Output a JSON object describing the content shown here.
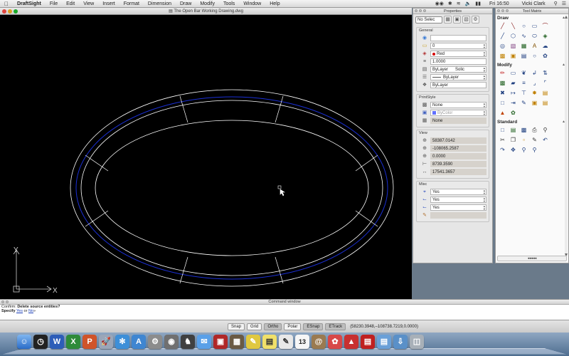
{
  "menubar": {
    "app_name": "DraftSight",
    "items": [
      "File",
      "Edit",
      "View",
      "Insert",
      "Format",
      "Dimension",
      "Draw",
      "Modify",
      "Tools",
      "Window",
      "Help"
    ],
    "clock": "Fri 16:50",
    "user": "Vicki Clark"
  },
  "drawing_window": {
    "title": "The Open Bar Working Drawing.dwg",
    "axis_y": "Y",
    "axis_x": "X",
    "colors": {
      "background": "#000000",
      "outline": "#ffffff",
      "centerline": "#1a2fd6"
    }
  },
  "properties": {
    "title": "Properties",
    "selector_value": "No Selec",
    "general": {
      "title": "General",
      "rows": [
        {
          "icon": "color-wheel-icon",
          "value": ""
        },
        {
          "icon": "layer-icon",
          "value": "0"
        },
        {
          "icon": "color-icon",
          "value": "Red"
        },
        {
          "icon": "scale-icon",
          "value": "1.0000"
        },
        {
          "icon": "linestyle-icon",
          "value": "ByLayer",
          "value2": "Solic"
        },
        {
          "icon": "lineweight-icon",
          "value": "ByLayer"
        },
        {
          "icon": "transparency-icon",
          "value": "ByLayer"
        }
      ]
    },
    "printstyle": {
      "title": "PrintStyle",
      "rows": [
        {
          "icon": "print-icon",
          "value": "None"
        },
        {
          "icon": "print-color-icon",
          "value": "ByColor"
        },
        {
          "icon": "print-table-icon",
          "value": "None"
        }
      ]
    },
    "view": {
      "title": "View",
      "rows": [
        {
          "icon": "center-x-icon",
          "value": "58387.0142"
        },
        {
          "icon": "center-y-icon",
          "value": "-108065.2587"
        },
        {
          "icon": "center-z-icon",
          "value": "0.0000"
        },
        {
          "icon": "height-icon",
          "value": "8739.3590"
        },
        {
          "icon": "width-icon",
          "value": "17541.3657"
        }
      ]
    },
    "misc": {
      "title": "Misc",
      "rows": [
        {
          "icon": "ucs-icon",
          "value": "Yes"
        },
        {
          "icon": "ucs-origin-icon",
          "value": "Yes"
        },
        {
          "icon": "ucs-per-viewport-icon",
          "value": "Yes"
        },
        {
          "icon": "ucs-name-icon",
          "value": ""
        }
      ]
    }
  },
  "tool_matrix": {
    "title": "Tool Matrix",
    "groups": [
      {
        "title": "Draw",
        "icons": [
          "line-icon",
          "polyline-icon",
          "circle-icon",
          "rectangle-icon",
          "arc-icon",
          "infinite-line-icon",
          "polygon-icon",
          "spline-icon",
          "ellipse-icon",
          "region-icon",
          "donut-icon",
          "hatch-icon",
          "table-icon",
          "text-icon",
          "cloud-icon",
          "block-icon",
          "point-icon",
          "wipeout-icon",
          "ring-icon",
          "revcloud-icon",
          "insert-block-icon"
        ]
      },
      {
        "title": "Modify",
        "icons": [
          "erase-icon",
          "move-icon",
          "copy-icon",
          "rotate-icon",
          "mirror-icon",
          "pattern-icon",
          "scale-icon",
          "offset-icon",
          "fillet-icon",
          "chamfer-icon",
          "trim-icon",
          "extend-icon",
          "break-icon",
          "explode-icon",
          "stretch-icon",
          "lengthen-icon",
          "join-icon",
          "edit-icon",
          "align-icon",
          "matchprop-icon",
          "paint-icon",
          "blend-icon"
        ]
      },
      {
        "title": "Standard",
        "icons": [
          "new-icon",
          "open-icon",
          "save-icon",
          "print-icon",
          "preview-icon",
          "cut-icon",
          "copy-icon",
          "paste-icon",
          "match-icon",
          "undo-icon",
          "redo-icon",
          "pan-icon",
          "zoom-icon",
          "zoom-window-icon"
        ]
      }
    ],
    "footer": "◂◂◂◂◂"
  },
  "command_window": {
    "title": "Command window",
    "line1_prefix": "Confirm:",
    "line1_text": "Delete source entities?",
    "line2_prefix": "Specify",
    "option_yes": "Yes",
    "line2_mid": "or",
    "option_no": "No",
    "line2_end": "»"
  },
  "statusbar": {
    "buttons": [
      {
        "label": "Snap",
        "on": false
      },
      {
        "label": "Grid",
        "on": false
      },
      {
        "label": "Ortho",
        "on": true
      },
      {
        "label": "Polar",
        "on": false
      },
      {
        "label": "ESnap",
        "on": true
      },
      {
        "label": "ETrack",
        "on": true
      }
    ],
    "coords": "(58230.3948,–108738.7219,0.0000)"
  },
  "dock": {
    "icons": [
      "finder-icon",
      "dashboard-icon",
      "word-icon",
      "excel-icon",
      "powerpoint-icon",
      "launchpad-icon",
      "safari-icon",
      "app-store-icon",
      "system-preferences-icon",
      "image-capture-icon",
      "chess-icon",
      "messages-icon",
      "photo-booth-icon",
      "preview-icon",
      "notes-icon",
      "stickies-icon",
      "textedit-icon",
      "calendar-icon",
      "address-book-icon",
      "photos-icon",
      "draftsight-icon",
      "pdf-icon",
      "folder-icon",
      "downloads-icon",
      "trash-icon"
    ],
    "calendar_day": "13"
  }
}
